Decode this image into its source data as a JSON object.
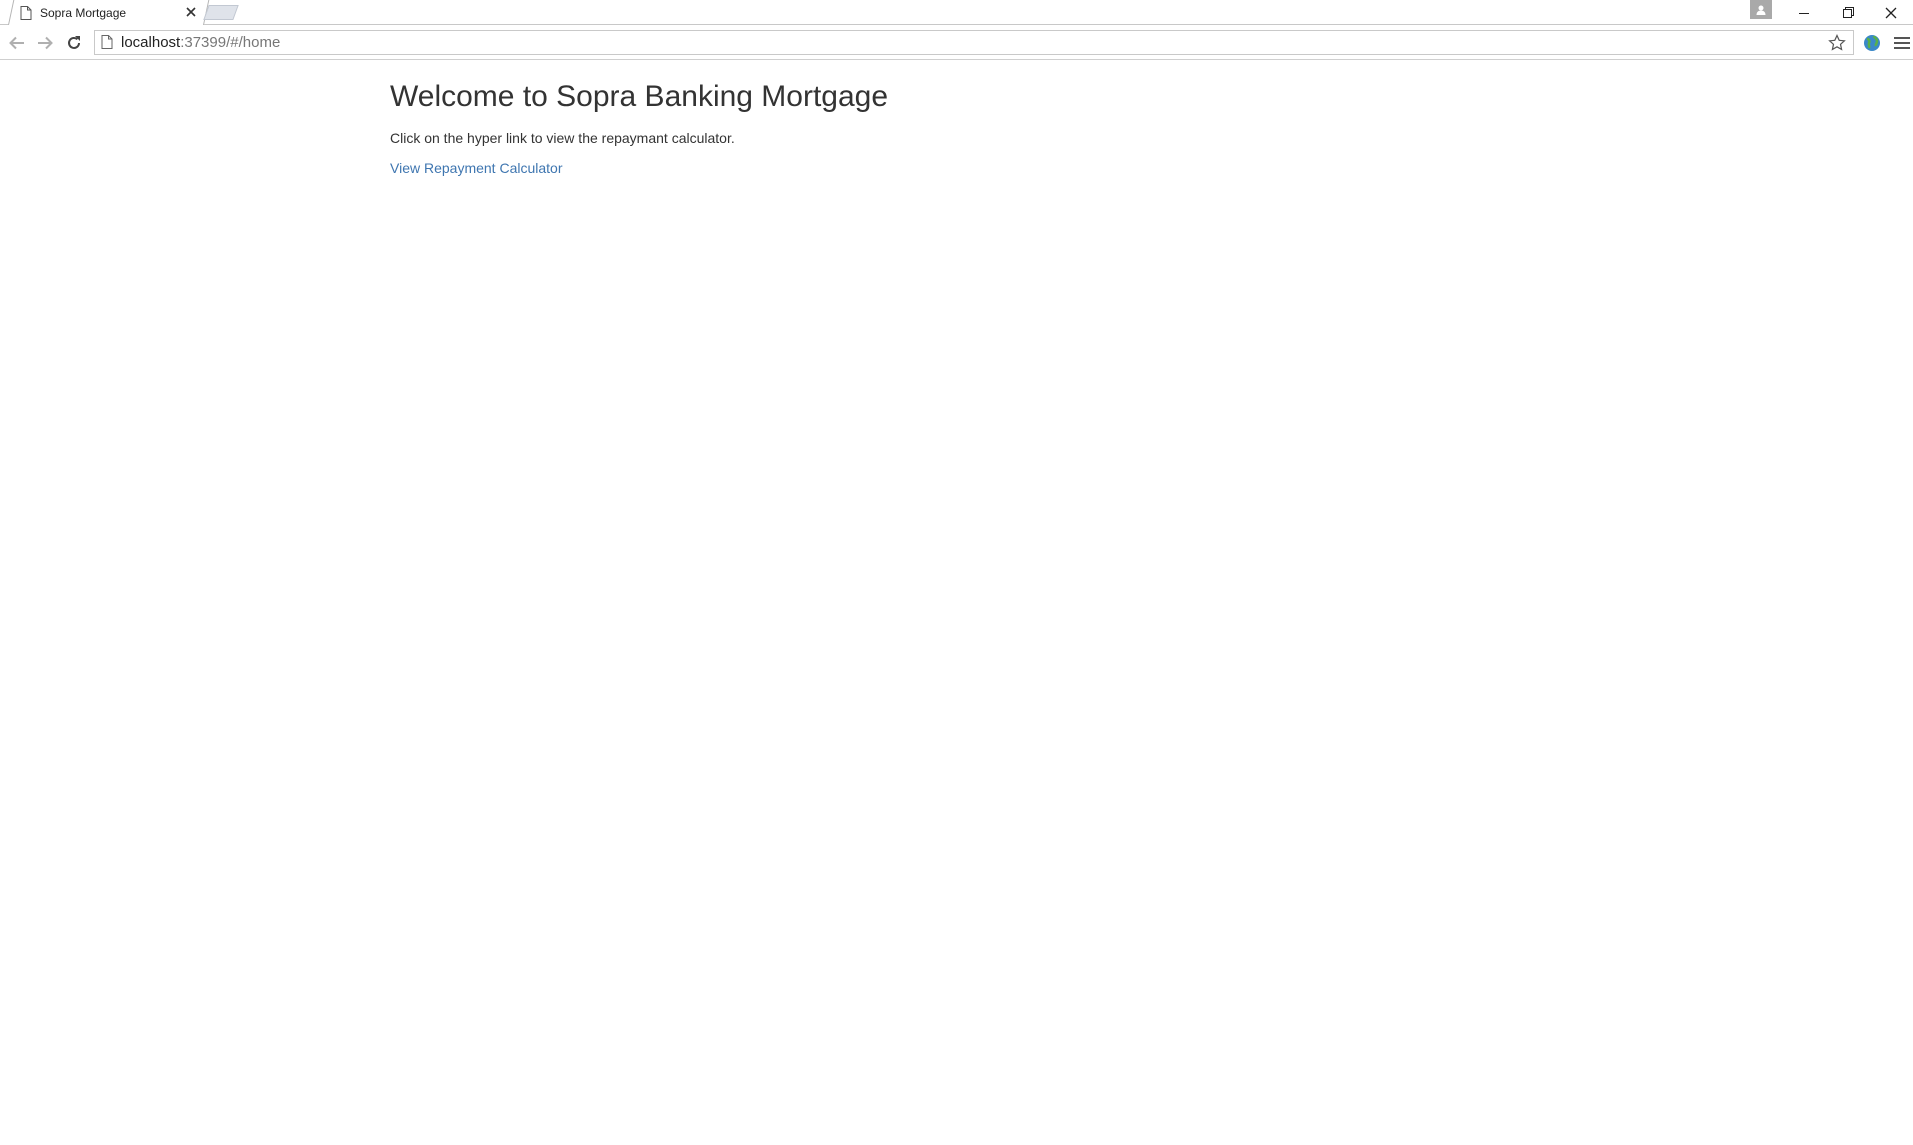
{
  "browser": {
    "tab": {
      "title": "Sopra Mortgage"
    },
    "address_bar": {
      "host": "localhost",
      "path": ":37399/#/home"
    }
  },
  "page": {
    "heading": "Welcome to Sopra Banking Mortgage",
    "instruction": "Click on the hyper link to view the repaymant calculator.",
    "link_label": "View Repayment Calculator"
  },
  "icons": {
    "tab_favicon": "page-icon",
    "tab_close": "close-icon",
    "back": "back-arrow-icon",
    "forward": "forward-arrow-icon",
    "reload": "reload-icon",
    "bookmark": "star-icon",
    "extension": "globe-icon",
    "menu": "hamburger-menu-icon",
    "profile": "person-icon"
  },
  "colors": {
    "link": "#3f76b0",
    "heading": "#333333"
  }
}
